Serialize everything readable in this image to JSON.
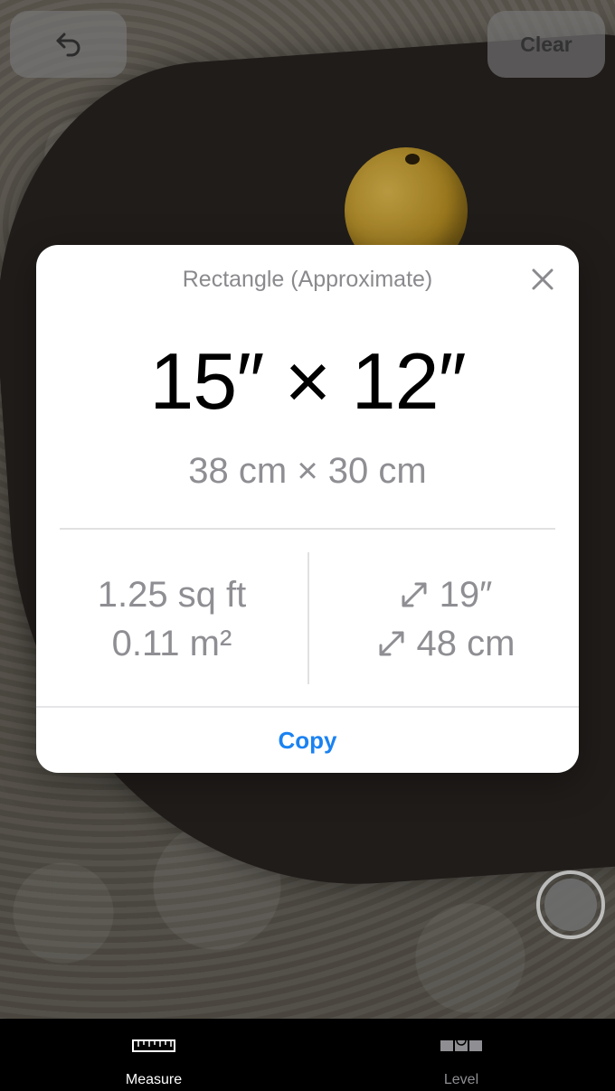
{
  "toolbar": {
    "undo_icon": "undo-arrow-icon",
    "clear_label": "Clear"
  },
  "card": {
    "title": "Rectangle (Approximate)",
    "close_icon": "close-x-icon",
    "main_measurement": "15″ × 12″",
    "metric_measurement": "38 cm × 30 cm",
    "area_imperial": "1.25 sq ft",
    "area_metric": "0.11 m²",
    "diagonal_imperial": "19″",
    "diagonal_metric": "48 cm",
    "diagonal_icon": "diagonal-expand-icon",
    "copy_label": "Copy"
  },
  "tabs": [
    {
      "label": "Measure",
      "icon": "ruler-icon",
      "active": true
    },
    {
      "label": "Level",
      "icon": "level-icon",
      "active": false
    }
  ],
  "colors": {
    "accent": "#1a82f2",
    "secondary_text": "#8e8e93"
  }
}
